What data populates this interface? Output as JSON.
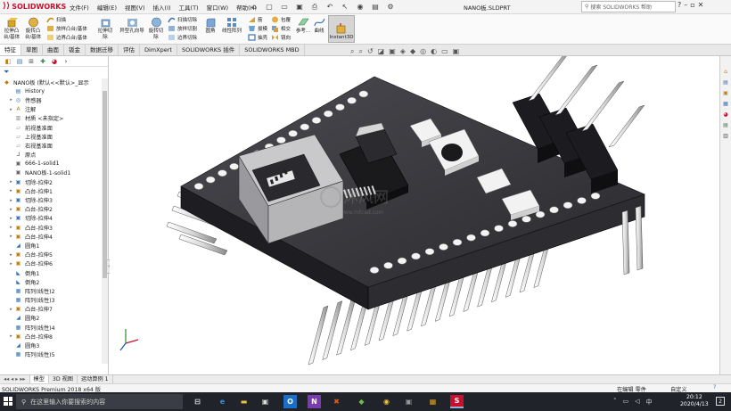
{
  "app": {
    "logo_text": "SOLIDWORKS",
    "doc_title": "NANO板.SLDPRT",
    "menu": [
      "文件(F)",
      "编辑(E)",
      "视图(V)",
      "插入(I)",
      "工具(T)",
      "窗口(W)",
      "帮助(H)"
    ],
    "help_search_placeholder": "搜索 SOLIDWORKS 帮助",
    "accent": "#c8102e"
  },
  "ribbon": {
    "big": [
      {
        "label": "拉伸凸\n台/基体"
      },
      {
        "label": "旋转凸\n台/基体"
      },
      {
        "label": "拉伸切\n除"
      },
      {
        "label": "异型孔向导"
      },
      {
        "label": "旋转切\n除"
      },
      {
        "label": "圆角"
      },
      {
        "label": "线性阵列"
      },
      {
        "label": "参考..."
      },
      {
        "label": "曲线"
      }
    ],
    "small": [
      {
        "label": "扫描"
      },
      {
        "label": "放样凸台/基体"
      },
      {
        "label": "边界凸台/基体"
      },
      {
        "label": "扫描切除"
      },
      {
        "label": "放样切割"
      },
      {
        "label": "边界切除"
      },
      {
        "label": "筋"
      },
      {
        "label": "拔模"
      },
      {
        "label": "抽壳"
      },
      {
        "label": "包覆"
      },
      {
        "label": "相交"
      },
      {
        "label": "镜向"
      }
    ],
    "instant3d": "Instant3D"
  },
  "tabs": [
    "特征",
    "草图",
    "曲面",
    "钣金",
    "数据迁移",
    "评估",
    "DimXpert",
    "SOLIDWORKS 插件",
    "SOLIDWORKS MBD"
  ],
  "tree": {
    "root": "NANO板 (默认<<默认>_显示",
    "items": [
      {
        "label": "History",
        "icon": "history-icon"
      },
      {
        "label": "传感器",
        "icon": "sensor-icon"
      },
      {
        "label": "注解",
        "icon": "annotation-icon"
      },
      {
        "label": "材质 <未指定>",
        "icon": "material-icon"
      },
      {
        "label": "前视基准面",
        "icon": "plane-icon"
      },
      {
        "label": "上视基准面",
        "icon": "plane-icon"
      },
      {
        "label": "右视基准面",
        "icon": "plane-icon"
      },
      {
        "label": "原点",
        "icon": "origin-icon"
      },
      {
        "label": "666-1-solid1",
        "icon": "solid-icon"
      },
      {
        "label": "NANO板-1-solid1",
        "icon": "solid-icon"
      },
      {
        "label": "切除-拉伸2",
        "icon": "cut-icon"
      },
      {
        "label": "凸台-拉伸1",
        "icon": "boss-icon"
      },
      {
        "label": "切除-拉伸3",
        "icon": "cut-icon"
      },
      {
        "label": "凸台-拉伸2",
        "icon": "boss-icon"
      },
      {
        "label": "切除-拉伸4",
        "icon": "cut-icon"
      },
      {
        "label": "凸台-拉伸3",
        "icon": "boss-icon"
      },
      {
        "label": "凸台-拉伸4",
        "icon": "boss-icon"
      },
      {
        "label": "圆角1",
        "icon": "fillet-icon"
      },
      {
        "label": "凸台-拉伸5",
        "icon": "boss-icon"
      },
      {
        "label": "凸台-拉伸6",
        "icon": "boss-icon"
      },
      {
        "label": "倒角1",
        "icon": "chamfer-icon"
      },
      {
        "label": "倒角2",
        "icon": "chamfer-icon"
      },
      {
        "label": "阵列(线性)2",
        "icon": "pattern-icon"
      },
      {
        "label": "阵列(线性)3",
        "icon": "pattern-icon"
      },
      {
        "label": "凸台-拉伸7",
        "icon": "boss-icon"
      },
      {
        "label": "圆角2",
        "icon": "fillet-icon"
      },
      {
        "label": "阵列(线性)4",
        "icon": "pattern-icon"
      },
      {
        "label": "凸台-拉伸8",
        "icon": "boss-icon"
      },
      {
        "label": "圆角3",
        "icon": "fillet-icon"
      },
      {
        "label": "阵列(线性)5",
        "icon": "pattern-icon"
      }
    ]
  },
  "watermark": {
    "title": "沐风网",
    "sub": "www.mfcad.com"
  },
  "bottom_tabs": [
    "模型",
    "3D 视图",
    "运动算例 1"
  ],
  "status": {
    "left": "SOLIDWORKS Premium 2018 x64 版",
    "mode": "在编辑 零件",
    "units": "自定义"
  },
  "taskbar": {
    "search_placeholder": "在这里输入你要搜索的内容",
    "time": "20:12",
    "date": "2020/4/13",
    "notif": "2"
  }
}
